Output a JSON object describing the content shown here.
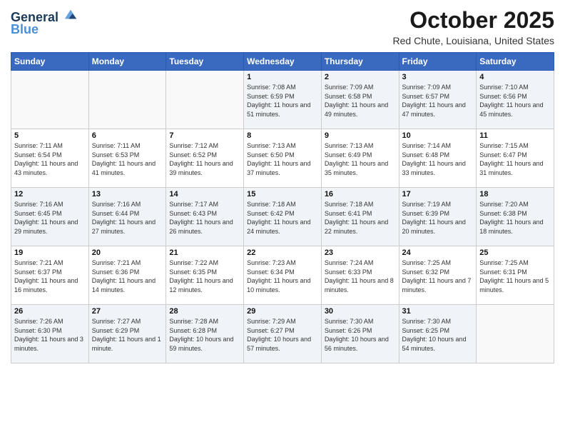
{
  "header": {
    "logo_line1": "General",
    "logo_line2": "Blue",
    "month": "October 2025",
    "location": "Red Chute, Louisiana, United States"
  },
  "weekdays": [
    "Sunday",
    "Monday",
    "Tuesday",
    "Wednesday",
    "Thursday",
    "Friday",
    "Saturday"
  ],
  "weeks": [
    [
      {
        "day": "",
        "sunrise": "",
        "sunset": "",
        "daylight": ""
      },
      {
        "day": "",
        "sunrise": "",
        "sunset": "",
        "daylight": ""
      },
      {
        "day": "",
        "sunrise": "",
        "sunset": "",
        "daylight": ""
      },
      {
        "day": "1",
        "sunrise": "Sunrise: 7:08 AM",
        "sunset": "Sunset: 6:59 PM",
        "daylight": "Daylight: 11 hours and 51 minutes."
      },
      {
        "day": "2",
        "sunrise": "Sunrise: 7:09 AM",
        "sunset": "Sunset: 6:58 PM",
        "daylight": "Daylight: 11 hours and 49 minutes."
      },
      {
        "day": "3",
        "sunrise": "Sunrise: 7:09 AM",
        "sunset": "Sunset: 6:57 PM",
        "daylight": "Daylight: 11 hours and 47 minutes."
      },
      {
        "day": "4",
        "sunrise": "Sunrise: 7:10 AM",
        "sunset": "Sunset: 6:56 PM",
        "daylight": "Daylight: 11 hours and 45 minutes."
      }
    ],
    [
      {
        "day": "5",
        "sunrise": "Sunrise: 7:11 AM",
        "sunset": "Sunset: 6:54 PM",
        "daylight": "Daylight: 11 hours and 43 minutes."
      },
      {
        "day": "6",
        "sunrise": "Sunrise: 7:11 AM",
        "sunset": "Sunset: 6:53 PM",
        "daylight": "Daylight: 11 hours and 41 minutes."
      },
      {
        "day": "7",
        "sunrise": "Sunrise: 7:12 AM",
        "sunset": "Sunset: 6:52 PM",
        "daylight": "Daylight: 11 hours and 39 minutes."
      },
      {
        "day": "8",
        "sunrise": "Sunrise: 7:13 AM",
        "sunset": "Sunset: 6:50 PM",
        "daylight": "Daylight: 11 hours and 37 minutes."
      },
      {
        "day": "9",
        "sunrise": "Sunrise: 7:13 AM",
        "sunset": "Sunset: 6:49 PM",
        "daylight": "Daylight: 11 hours and 35 minutes."
      },
      {
        "day": "10",
        "sunrise": "Sunrise: 7:14 AM",
        "sunset": "Sunset: 6:48 PM",
        "daylight": "Daylight: 11 hours and 33 minutes."
      },
      {
        "day": "11",
        "sunrise": "Sunrise: 7:15 AM",
        "sunset": "Sunset: 6:47 PM",
        "daylight": "Daylight: 11 hours and 31 minutes."
      }
    ],
    [
      {
        "day": "12",
        "sunrise": "Sunrise: 7:16 AM",
        "sunset": "Sunset: 6:45 PM",
        "daylight": "Daylight: 11 hours and 29 minutes."
      },
      {
        "day": "13",
        "sunrise": "Sunrise: 7:16 AM",
        "sunset": "Sunset: 6:44 PM",
        "daylight": "Daylight: 11 hours and 27 minutes."
      },
      {
        "day": "14",
        "sunrise": "Sunrise: 7:17 AM",
        "sunset": "Sunset: 6:43 PM",
        "daylight": "Daylight: 11 hours and 26 minutes."
      },
      {
        "day": "15",
        "sunrise": "Sunrise: 7:18 AM",
        "sunset": "Sunset: 6:42 PM",
        "daylight": "Daylight: 11 hours and 24 minutes."
      },
      {
        "day": "16",
        "sunrise": "Sunrise: 7:18 AM",
        "sunset": "Sunset: 6:41 PM",
        "daylight": "Daylight: 11 hours and 22 minutes."
      },
      {
        "day": "17",
        "sunrise": "Sunrise: 7:19 AM",
        "sunset": "Sunset: 6:39 PM",
        "daylight": "Daylight: 11 hours and 20 minutes."
      },
      {
        "day": "18",
        "sunrise": "Sunrise: 7:20 AM",
        "sunset": "Sunset: 6:38 PM",
        "daylight": "Daylight: 11 hours and 18 minutes."
      }
    ],
    [
      {
        "day": "19",
        "sunrise": "Sunrise: 7:21 AM",
        "sunset": "Sunset: 6:37 PM",
        "daylight": "Daylight: 11 hours and 16 minutes."
      },
      {
        "day": "20",
        "sunrise": "Sunrise: 7:21 AM",
        "sunset": "Sunset: 6:36 PM",
        "daylight": "Daylight: 11 hours and 14 minutes."
      },
      {
        "day": "21",
        "sunrise": "Sunrise: 7:22 AM",
        "sunset": "Sunset: 6:35 PM",
        "daylight": "Daylight: 11 hours and 12 minutes."
      },
      {
        "day": "22",
        "sunrise": "Sunrise: 7:23 AM",
        "sunset": "Sunset: 6:34 PM",
        "daylight": "Daylight: 11 hours and 10 minutes."
      },
      {
        "day": "23",
        "sunrise": "Sunrise: 7:24 AM",
        "sunset": "Sunset: 6:33 PM",
        "daylight": "Daylight: 11 hours and 8 minutes."
      },
      {
        "day": "24",
        "sunrise": "Sunrise: 7:25 AM",
        "sunset": "Sunset: 6:32 PM",
        "daylight": "Daylight: 11 hours and 7 minutes."
      },
      {
        "day": "25",
        "sunrise": "Sunrise: 7:25 AM",
        "sunset": "Sunset: 6:31 PM",
        "daylight": "Daylight: 11 hours and 5 minutes."
      }
    ],
    [
      {
        "day": "26",
        "sunrise": "Sunrise: 7:26 AM",
        "sunset": "Sunset: 6:30 PM",
        "daylight": "Daylight: 11 hours and 3 minutes."
      },
      {
        "day": "27",
        "sunrise": "Sunrise: 7:27 AM",
        "sunset": "Sunset: 6:29 PM",
        "daylight": "Daylight: 11 hours and 1 minute."
      },
      {
        "day": "28",
        "sunrise": "Sunrise: 7:28 AM",
        "sunset": "Sunset: 6:28 PM",
        "daylight": "Daylight: 10 hours and 59 minutes."
      },
      {
        "day": "29",
        "sunrise": "Sunrise: 7:29 AM",
        "sunset": "Sunset: 6:27 PM",
        "daylight": "Daylight: 10 hours and 57 minutes."
      },
      {
        "day": "30",
        "sunrise": "Sunrise: 7:30 AM",
        "sunset": "Sunset: 6:26 PM",
        "daylight": "Daylight: 10 hours and 56 minutes."
      },
      {
        "day": "31",
        "sunrise": "Sunrise: 7:30 AM",
        "sunset": "Sunset: 6:25 PM",
        "daylight": "Daylight: 10 hours and 54 minutes."
      },
      {
        "day": "",
        "sunrise": "",
        "sunset": "",
        "daylight": ""
      }
    ]
  ]
}
